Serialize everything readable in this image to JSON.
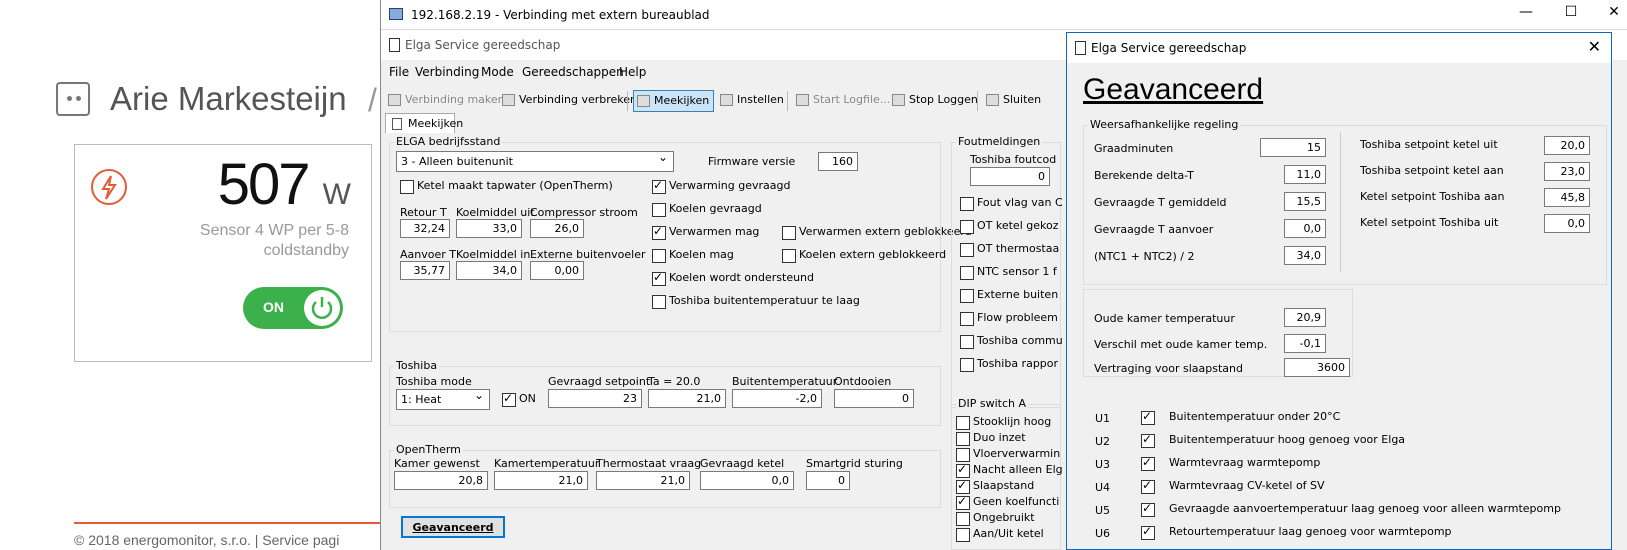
{
  "background": {
    "user_name": "Arie Markesteijn",
    "slash": "/",
    "power_value": "507",
    "power_unit": "W",
    "sensor_line1": "Sensor 4 WP per 5-8",
    "sensor_line2": "coldstandby",
    "toggle_label": "ON",
    "footer": "© 2018 energomonitor, s.r.o. | Service pagi",
    "accent": "#e55b36",
    "toggle_color": "#3cb04a"
  },
  "rdp": {
    "title": "192.168.2.19 - Verbinding met extern bureaublad"
  },
  "app": {
    "title": "Elga Service gereedschap",
    "menu": [
      "File",
      "Verbinding",
      "Mode",
      "Gereedschappen",
      "Help"
    ],
    "toolbar": {
      "connect": "Verbinding maken",
      "disconnect": "Verbinding verbreken",
      "watch": "Meekijken",
      "settings": "Instellen",
      "start_log": "Start Logfile...",
      "stop_log": "Stop Loggen",
      "close": "Sluiten"
    },
    "tab": "Meekijken",
    "elga": {
      "group": "ELGA bedrijfsstand",
      "mode": "3 - Alleen buitenunit",
      "firmware_label": "Firmware versie",
      "firmware": "160",
      "ketel_tapwater": "Ketel maakt tapwater (OpenTherm)",
      "retour_label": "Retour T",
      "retour": "32,24",
      "koel_uit_label": "Koelmiddel uit",
      "koel_uit": "33,0",
      "comp_label": "Compressor stroom",
      "comp": "26,0",
      "aanvoer_label": "Aanvoer T",
      "aanvoer": "35,77",
      "koel_in_label": "Koelmiddel in",
      "koel_in": "34,0",
      "ext_label": "Externe buitenvoeler",
      "ext": "0,00",
      "verwarming": "Verwarming gevraagd",
      "koelen": "Koelen gevraagd",
      "verwarmen_mag": "Verwarmen mag",
      "verwarmen_ext": "Verwarmen extern geblokkeerd",
      "koelen_mag": "Koelen mag",
      "koelen_ext": "Koelen extern geblokkeerd",
      "koelen_ondersteund": "Koelen wordt ondersteund",
      "toshiba_laag": "Toshiba buitentemperatuur te laag"
    },
    "toshiba": {
      "group": "Toshiba",
      "mode_label": "Toshiba mode",
      "mode": "1: Heat",
      "on_label": "ON",
      "setpoint_label": "Gevraagd setpoint",
      "setpoint": "23",
      "ta_label": "Ta = 20.0",
      "ta": "21,0",
      "buiten_label": "Buitentemperatuur",
      "buiten": "-2,0",
      "ontdooien_label": "Ontdooien",
      "ontdooien": "0"
    },
    "opentherm": {
      "group": "OpenTherm",
      "kamer_gewenst_label": "Kamer gewenst",
      "kamer_gewenst": "20,8",
      "kamertemp_label": "Kamertemperatuur",
      "kamertemp": "21,0",
      "thermostaat_label": "Thermostaat vraag",
      "thermostaat": "21,0",
      "ketel_label": "Gevraagd ketel",
      "ketel": "0,0",
      "smartgrid_label": "Smartgrid sturing",
      "smartgrid": "0"
    },
    "advanced_button": "Geavanceerd",
    "fout": {
      "group": "Foutmeldingen",
      "toshiba_code_label": "Toshiba foutcod",
      "toshiba_code": "0",
      "items": [
        "Fout vlag van C",
        "OT ketel gekoz",
        "OT thermostaa",
        "NTC sensor 1 f",
        "Externe buiten",
        "Flow probleem",
        "Toshiba commu",
        "Toshiba rappor"
      ]
    },
    "dip": {
      "group": "DIP switch A",
      "items": [
        "Stooklijn hoog",
        "Duo inzet",
        "Vloerverwarmin",
        "Nacht alleen Elg",
        "Slaapstand",
        "Geen koelfuncti",
        "Ongebruikt",
        "Aan/Uit ketel"
      ]
    }
  },
  "dialog": {
    "title": "Elga Service gereedschap",
    "heading": "Geavanceerd",
    "weather": {
      "group": "Weersafhankelijke regeling",
      "graadminuten_label": "Graadminuten",
      "graadminuten": "15",
      "delta_label": "Berekende delta-T",
      "delta": "11,0",
      "gemiddeld_label": "Gevraagde T gemiddeld",
      "gemiddeld": "15,5",
      "aanvoer_label": "Gevraagde T aanvoer",
      "aanvoer": "0,0",
      "ntc_label": "(NTC1 + NTC2) / 2",
      "ntc": "34,0",
      "sp_uit_label": "Toshiba setpoint ketel uit",
      "sp_uit": "20,0",
      "sp_aan_label": "Toshiba setpoint ketel aan",
      "sp_aan": "23,0",
      "ks_aan_label": "Ketel setpoint Toshiba aan",
      "ks_aan": "45,8",
      "ks_uit_label": "Ketel setpoint Toshiba uit",
      "ks_uit": "0,0"
    },
    "room": {
      "oude_label": "Oude kamer temperatuur",
      "oude": "20,9",
      "verschil_label": "Verschil met oude kamer temp.",
      "verschil": "-0,1",
      "vertraging_label": "Vertraging voor slaapstand",
      "vertraging": "3600"
    },
    "conditions": [
      {
        "code": "U1",
        "text": "Buitentemperatuur onder 20°C"
      },
      {
        "code": "U2",
        "text": "Buitentemperatuur hoog genoeg voor Elga"
      },
      {
        "code": "U3",
        "text": "Warmtevraag warmtepomp"
      },
      {
        "code": "U4",
        "text": "Warmtevraag CV-ketel of SV"
      },
      {
        "code": "U5",
        "text": "Gevraagde aanvoertemperatuur laag genoeg voor alleen warmtepomp"
      },
      {
        "code": "U6",
        "text": "Retourtemperatuur laag genoeg voor warmtepomp"
      }
    ]
  }
}
